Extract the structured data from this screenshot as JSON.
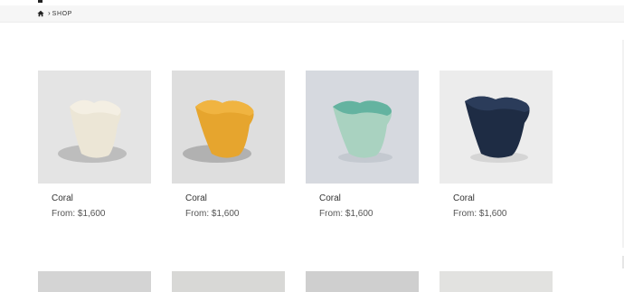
{
  "breadcrumb": {
    "home_icon": "home-icon",
    "separator": "›",
    "current": "SHOP"
  },
  "products": [
    {
      "name": "Coral",
      "price": "From: $1,600",
      "color": "#ece6d6",
      "rim": "#f4efe3",
      "shadow": "#9d9d9d",
      "bg": "#e4e4e4"
    },
    {
      "name": "Coral",
      "price": "From: $1,600",
      "color": "#e6a52e",
      "rim": "#f0b441",
      "shadow": "#8d8d8d",
      "bg": "#dedede"
    },
    {
      "name": "Coral",
      "price": "From: $1,600",
      "color": "#a9d2c0",
      "rim": "#64b3a0",
      "shadow": "#b8bec6",
      "bg": "#d6d9df"
    },
    {
      "name": "Coral",
      "price": "From: $1,600",
      "color": "#1e2c44",
      "rim": "#2b3c5a",
      "shadow": "#c6c6c6",
      "bg": "#ececec"
    }
  ]
}
